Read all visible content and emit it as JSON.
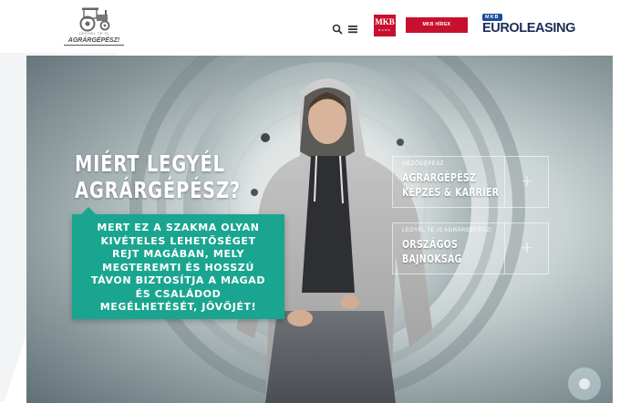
{
  "header": {
    "logo_small": "LEGYÉL TE IS",
    "logo_main": "AGRÁRGÉPÉSZ!",
    "mkb_bank": {
      "top": "MKB",
      "bottom": "BANK"
    },
    "mkb_news": "MKB HÍREK",
    "euroleasing": {
      "badge": "MKB",
      "word": "EUROLEASING"
    },
    "icons": [
      "search-icon",
      "hamburger-menu-icon"
    ]
  },
  "hero": {
    "title_line1": "MIÉRT LEGYÉL",
    "title_line2": "AGRÁRGÉPÉSZ?",
    "box_text_lines": [
      "MERT EZ A SZAKMA OLYAN",
      "KIVÉTELES LEHETŐSÉGET",
      "REJT MAGÁBAN, MELY",
      "MEGTEREMTI ÉS HOSSZÚ",
      "TÁVON BIZTOSÍTJA A MAGAD",
      "ÉS CSALÁDOD",
      "MEGÉLHETÉSÉT, JÖVŐJÉT!"
    ],
    "cards": [
      {
        "small": "MEZŐGÉPÉSZ",
        "title_line1": "AGRÁRGÉPÉSZ",
        "title_line2": "KÉPZÉS & KARRIER",
        "plus": "+"
      },
      {
        "small": "LEGYÉL TE IS AGRÁRGÉPÉSZ!",
        "title_line1": "ORSZÁGOS",
        "title_line2": "BAJNOKSÁG",
        "plus": "+"
      }
    ]
  },
  "colors": {
    "accent_teal": "#1aa590",
    "mkb_red": "#c8102e",
    "euroleasing_blue": "#1b2d55"
  }
}
